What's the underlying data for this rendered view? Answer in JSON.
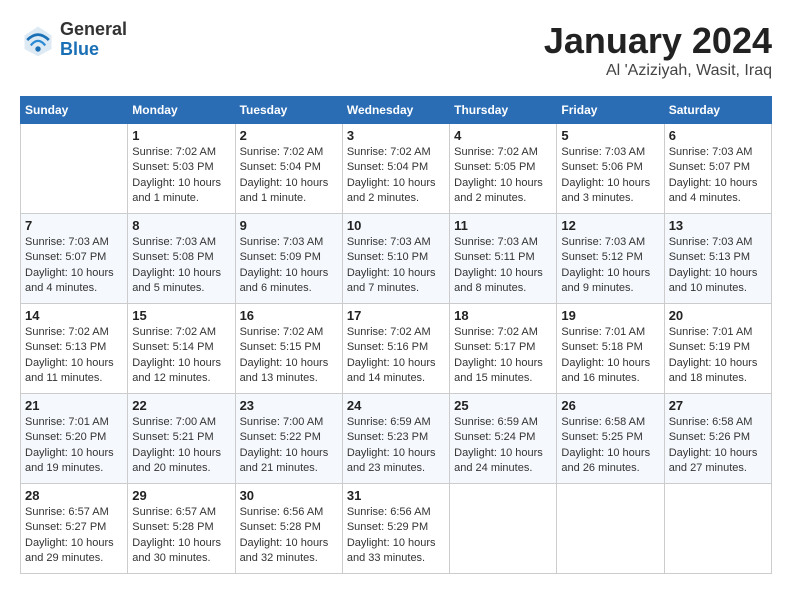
{
  "header": {
    "logo": {
      "general": "General",
      "blue": "Blue"
    },
    "title": "January 2024",
    "location": "Al 'Aziziyah, Wasit, Iraq"
  },
  "calendar": {
    "days_of_week": [
      "Sunday",
      "Monday",
      "Tuesday",
      "Wednesday",
      "Thursday",
      "Friday",
      "Saturday"
    ],
    "weeks": [
      [
        {
          "day": "",
          "sunrise": "",
          "sunset": "",
          "daylight": ""
        },
        {
          "day": "1",
          "sunrise": "Sunrise: 7:02 AM",
          "sunset": "Sunset: 5:03 PM",
          "daylight": "Daylight: 10 hours and 1 minute."
        },
        {
          "day": "2",
          "sunrise": "Sunrise: 7:02 AM",
          "sunset": "Sunset: 5:04 PM",
          "daylight": "Daylight: 10 hours and 1 minute."
        },
        {
          "day": "3",
          "sunrise": "Sunrise: 7:02 AM",
          "sunset": "Sunset: 5:04 PM",
          "daylight": "Daylight: 10 hours and 2 minutes."
        },
        {
          "day": "4",
          "sunrise": "Sunrise: 7:02 AM",
          "sunset": "Sunset: 5:05 PM",
          "daylight": "Daylight: 10 hours and 2 minutes."
        },
        {
          "day": "5",
          "sunrise": "Sunrise: 7:03 AM",
          "sunset": "Sunset: 5:06 PM",
          "daylight": "Daylight: 10 hours and 3 minutes."
        },
        {
          "day": "6",
          "sunrise": "Sunrise: 7:03 AM",
          "sunset": "Sunset: 5:07 PM",
          "daylight": "Daylight: 10 hours and 4 minutes."
        }
      ],
      [
        {
          "day": "7",
          "sunrise": "Sunrise: 7:03 AM",
          "sunset": "Sunset: 5:07 PM",
          "daylight": "Daylight: 10 hours and 4 minutes."
        },
        {
          "day": "8",
          "sunrise": "Sunrise: 7:03 AM",
          "sunset": "Sunset: 5:08 PM",
          "daylight": "Daylight: 10 hours and 5 minutes."
        },
        {
          "day": "9",
          "sunrise": "Sunrise: 7:03 AM",
          "sunset": "Sunset: 5:09 PM",
          "daylight": "Daylight: 10 hours and 6 minutes."
        },
        {
          "day": "10",
          "sunrise": "Sunrise: 7:03 AM",
          "sunset": "Sunset: 5:10 PM",
          "daylight": "Daylight: 10 hours and 7 minutes."
        },
        {
          "day": "11",
          "sunrise": "Sunrise: 7:03 AM",
          "sunset": "Sunset: 5:11 PM",
          "daylight": "Daylight: 10 hours and 8 minutes."
        },
        {
          "day": "12",
          "sunrise": "Sunrise: 7:03 AM",
          "sunset": "Sunset: 5:12 PM",
          "daylight": "Daylight: 10 hours and 9 minutes."
        },
        {
          "day": "13",
          "sunrise": "Sunrise: 7:03 AM",
          "sunset": "Sunset: 5:13 PM",
          "daylight": "Daylight: 10 hours and 10 minutes."
        }
      ],
      [
        {
          "day": "14",
          "sunrise": "Sunrise: 7:02 AM",
          "sunset": "Sunset: 5:13 PM",
          "daylight": "Daylight: 10 hours and 11 minutes."
        },
        {
          "day": "15",
          "sunrise": "Sunrise: 7:02 AM",
          "sunset": "Sunset: 5:14 PM",
          "daylight": "Daylight: 10 hours and 12 minutes."
        },
        {
          "day": "16",
          "sunrise": "Sunrise: 7:02 AM",
          "sunset": "Sunset: 5:15 PM",
          "daylight": "Daylight: 10 hours and 13 minutes."
        },
        {
          "day": "17",
          "sunrise": "Sunrise: 7:02 AM",
          "sunset": "Sunset: 5:16 PM",
          "daylight": "Daylight: 10 hours and 14 minutes."
        },
        {
          "day": "18",
          "sunrise": "Sunrise: 7:02 AM",
          "sunset": "Sunset: 5:17 PM",
          "daylight": "Daylight: 10 hours and 15 minutes."
        },
        {
          "day": "19",
          "sunrise": "Sunrise: 7:01 AM",
          "sunset": "Sunset: 5:18 PM",
          "daylight": "Daylight: 10 hours and 16 minutes."
        },
        {
          "day": "20",
          "sunrise": "Sunrise: 7:01 AM",
          "sunset": "Sunset: 5:19 PM",
          "daylight": "Daylight: 10 hours and 18 minutes."
        }
      ],
      [
        {
          "day": "21",
          "sunrise": "Sunrise: 7:01 AM",
          "sunset": "Sunset: 5:20 PM",
          "daylight": "Daylight: 10 hours and 19 minutes."
        },
        {
          "day": "22",
          "sunrise": "Sunrise: 7:00 AM",
          "sunset": "Sunset: 5:21 PM",
          "daylight": "Daylight: 10 hours and 20 minutes."
        },
        {
          "day": "23",
          "sunrise": "Sunrise: 7:00 AM",
          "sunset": "Sunset: 5:22 PM",
          "daylight": "Daylight: 10 hours and 21 minutes."
        },
        {
          "day": "24",
          "sunrise": "Sunrise: 6:59 AM",
          "sunset": "Sunset: 5:23 PM",
          "daylight": "Daylight: 10 hours and 23 minutes."
        },
        {
          "day": "25",
          "sunrise": "Sunrise: 6:59 AM",
          "sunset": "Sunset: 5:24 PM",
          "daylight": "Daylight: 10 hours and 24 minutes."
        },
        {
          "day": "26",
          "sunrise": "Sunrise: 6:58 AM",
          "sunset": "Sunset: 5:25 PM",
          "daylight": "Daylight: 10 hours and 26 minutes."
        },
        {
          "day": "27",
          "sunrise": "Sunrise: 6:58 AM",
          "sunset": "Sunset: 5:26 PM",
          "daylight": "Daylight: 10 hours and 27 minutes."
        }
      ],
      [
        {
          "day": "28",
          "sunrise": "Sunrise: 6:57 AM",
          "sunset": "Sunset: 5:27 PM",
          "daylight": "Daylight: 10 hours and 29 minutes."
        },
        {
          "day": "29",
          "sunrise": "Sunrise: 6:57 AM",
          "sunset": "Sunset: 5:28 PM",
          "daylight": "Daylight: 10 hours and 30 minutes."
        },
        {
          "day": "30",
          "sunrise": "Sunrise: 6:56 AM",
          "sunset": "Sunset: 5:28 PM",
          "daylight": "Daylight: 10 hours and 32 minutes."
        },
        {
          "day": "31",
          "sunrise": "Sunrise: 6:56 AM",
          "sunset": "Sunset: 5:29 PM",
          "daylight": "Daylight: 10 hours and 33 minutes."
        },
        {
          "day": "",
          "sunrise": "",
          "sunset": "",
          "daylight": ""
        },
        {
          "day": "",
          "sunrise": "",
          "sunset": "",
          "daylight": ""
        },
        {
          "day": "",
          "sunrise": "",
          "sunset": "",
          "daylight": ""
        }
      ]
    ]
  }
}
